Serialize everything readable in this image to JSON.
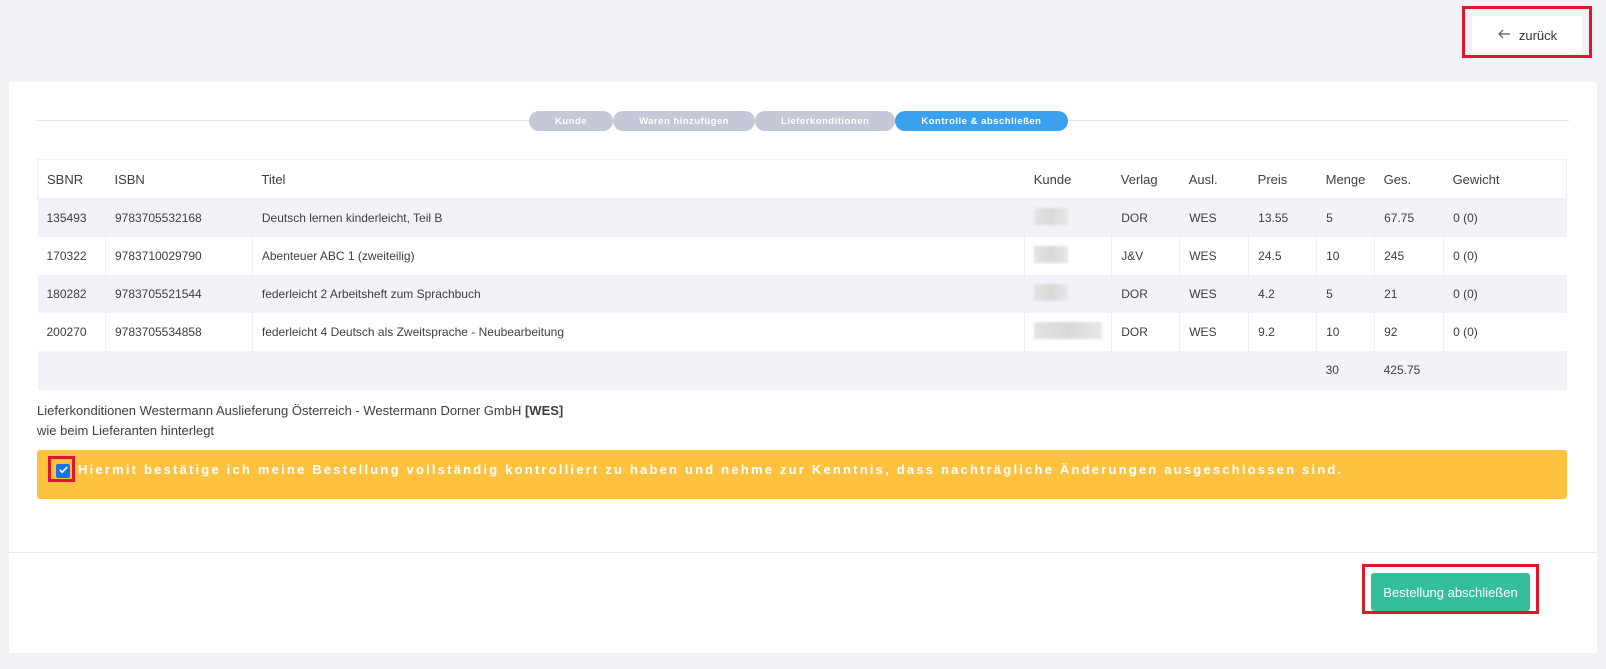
{
  "header": {
    "back_label": "zurück",
    "back_icon": "arrow-left-icon"
  },
  "stepper": {
    "steps": [
      {
        "label": "Kunde",
        "active": false
      },
      {
        "label": "Waren hinzufügen",
        "active": false
      },
      {
        "label": "Lieferkonditionen",
        "active": false
      },
      {
        "label": "Kontrolle & abschließen",
        "active": true
      }
    ]
  },
  "table": {
    "columns": [
      "SBNR",
      "ISBN",
      "Titel",
      "Kunde",
      "Verlag",
      "Ausl.",
      "Preis",
      "Menge",
      "Ges.",
      "Gewicht"
    ],
    "rows": [
      {
        "sbnr": "135493",
        "isbn": "9783705532168",
        "titel": "Deutsch lernen kinderleicht, Teil B",
        "kunde": "",
        "verlag": "DOR",
        "ausl": "WES",
        "preis": "13.55",
        "menge": "5",
        "ges": "67.75",
        "gewicht": "0 (0)"
      },
      {
        "sbnr": "170322",
        "isbn": "9783710029790",
        "titel": "Abenteuer ABC 1 (zweiteilig)",
        "kunde": "",
        "verlag": "J&V",
        "ausl": "WES",
        "preis": "24.5",
        "menge": "10",
        "ges": "245",
        "gewicht": "0 (0)"
      },
      {
        "sbnr": "180282",
        "isbn": "9783705521544",
        "titel": "federleicht 2 Arbeitsheft zum Sprachbuch",
        "kunde": "",
        "verlag": "DOR",
        "ausl": "WES",
        "preis": "4.2",
        "menge": "5",
        "ges": "21",
        "gewicht": "0 (0)"
      },
      {
        "sbnr": "200270",
        "isbn": "9783705534858",
        "titel": "federleicht 4 Deutsch als Zweitsprache - Neubearbeitung",
        "kunde": "",
        "verlag": "DOR",
        "ausl": "WES",
        "preis": "9.2",
        "menge": "10",
        "ges": "92",
        "gewicht": "0 (0)"
      }
    ],
    "totals": {
      "menge": "30",
      "ges": "425.75"
    }
  },
  "conditions": {
    "line1_prefix": "Lieferkonditionen Westermann Auslieferung Österreich - Westermann Dorner GmbH ",
    "line1_code": "[WES]",
    "line2": "wie beim Lieferanten hinterlegt"
  },
  "confirm": {
    "checked": true,
    "text": "Hiermit bestätige ich meine Bestellung vollständig kontrolliert zu haben und nehme zur Kenntnis, dass nachträgliche Änderungen ausgeschlossen sind."
  },
  "footer": {
    "submit_label": "Bestellung abschließen"
  },
  "colors": {
    "accent": "#3aa0f0",
    "step_inactive": "#c5c8d6",
    "warning": "#ffc23f",
    "submit": "#34bf9b",
    "highlight": "#e0162b"
  }
}
